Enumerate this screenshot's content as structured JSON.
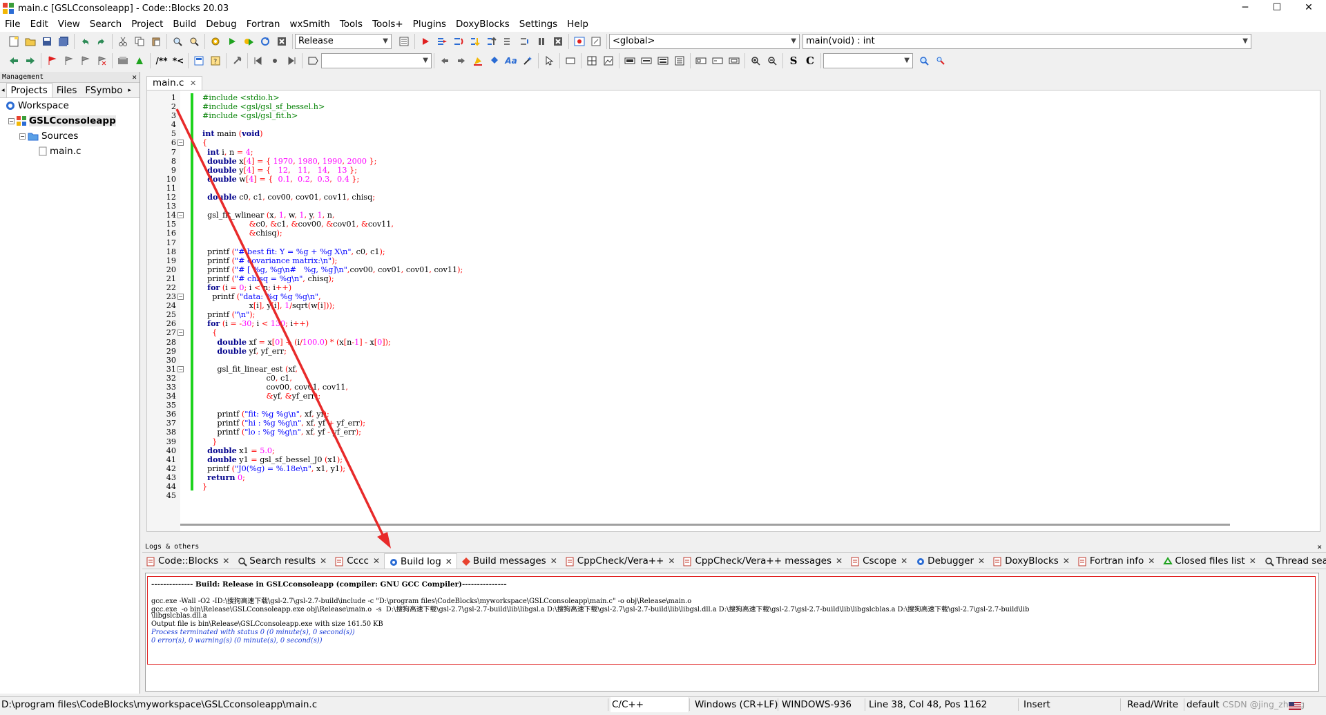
{
  "window": {
    "title": "main.c [GSLCconsoleapp] - Code::Blocks 20.03",
    "controls": [
      "─",
      "☐",
      "✕"
    ]
  },
  "menu": [
    "File",
    "Edit",
    "View",
    "Search",
    "Project",
    "Build",
    "Debug",
    "Fortran",
    "wxSmith",
    "Tools",
    "Tools+",
    "Plugins",
    "DoxyBlocks",
    "Settings",
    "Help"
  ],
  "toolbar": {
    "build_target": "Release",
    "scope": "<global>",
    "function": "main(void) : int",
    "search_value": "",
    "search2_value": ""
  },
  "management": {
    "title": "Management",
    "close": "✕",
    "tabs": [
      "Projects",
      "Files",
      "FSymbo"
    ],
    "tree": [
      {
        "label": "Workspace",
        "level": 0,
        "icon": "workspace-icon",
        "bold": false
      },
      {
        "label": "GSLCconsoleapp",
        "level": 1,
        "icon": "project-icon",
        "bold": true
      },
      {
        "label": "Sources",
        "level": 2,
        "icon": "folder-icon",
        "bold": false
      },
      {
        "label": "main.c",
        "level": 3,
        "icon": "file-icon",
        "bold": false
      }
    ]
  },
  "editor": {
    "tab": "main.c",
    "tab_close": "✕",
    "lines": [
      {
        "n": "1",
        "code": "#include <stdio.h>",
        "cls": "pp"
      },
      {
        "n": "2",
        "code": "#include <gsl/gsl_sf_bessel.h>",
        "cls": "pp"
      },
      {
        "n": "3",
        "code": "#include <gsl/gsl_fit.h>",
        "cls": "pp"
      },
      {
        "n": "4",
        "code": "",
        "cls": ""
      },
      {
        "n": "5",
        "code": "int main (void)",
        "cls": "mix"
      },
      {
        "n": "6",
        "code": "{",
        "cls": "op",
        "fold": "−"
      },
      {
        "n": "7",
        "code": "  int i, n = 4;",
        "cls": "mix"
      },
      {
        "n": "8",
        "code": "  double x[4] = { 1970, 1980, 1990, 2000 };",
        "cls": "mix"
      },
      {
        "n": "9",
        "code": "  double y[4] = {   12,   11,   14,   13 };",
        "cls": "mix"
      },
      {
        "n": "10",
        "code": "  double w[4] = {  0.1,  0.2,  0.3,  0.4 };",
        "cls": "mix"
      },
      {
        "n": "11",
        "code": "",
        "cls": ""
      },
      {
        "n": "12",
        "code": "  double c0, c1, cov00, cov01, cov11, chisq;",
        "cls": "mix"
      },
      {
        "n": "13",
        "code": "",
        "cls": ""
      },
      {
        "n": "14",
        "code": "  gsl_fit_wlinear (x, 1, w, 1, y, 1, n,",
        "cls": "mix",
        "fold": "−"
      },
      {
        "n": "15",
        "code": "                   &c0, &c1, &cov00, &cov01, &cov11,",
        "cls": "mix"
      },
      {
        "n": "16",
        "code": "                   &chisq);",
        "cls": "mix"
      },
      {
        "n": "17",
        "code": "",
        "cls": ""
      },
      {
        "n": "18",
        "code": "  printf (\"# best fit: Y = %g + %g X\\n\", c0, c1);",
        "cls": "mix"
      },
      {
        "n": "19",
        "code": "  printf (\"# covariance matrix:\\n\");",
        "cls": "mix"
      },
      {
        "n": "20",
        "code": "  printf (\"# [ %g, %g\\n#   %g, %g]\\n\",cov00, cov01, cov01, cov11);",
        "cls": "mix"
      },
      {
        "n": "21",
        "code": "  printf (\"# chisq = %g\\n\", chisq);",
        "cls": "mix"
      },
      {
        "n": "22",
        "code": "  for (i = 0; i < n; i++)",
        "cls": "mix"
      },
      {
        "n": "23",
        "code": "    printf (\"data: %g %g %g\\n\",",
        "cls": "mix",
        "fold": "−"
      },
      {
        "n": "24",
        "code": "                   x[i], y[i], 1/sqrt(w[i]));",
        "cls": "mix"
      },
      {
        "n": "25",
        "code": "  printf (\"\\n\");",
        "cls": "mix"
      },
      {
        "n": "26",
        "code": "  for (i = -30; i < 130; i++)",
        "cls": "mix"
      },
      {
        "n": "27",
        "code": "    {",
        "cls": "op",
        "fold": "−"
      },
      {
        "n": "28",
        "code": "      double xf = x[0] + (i/100.0) * (x[n-1] - x[0]);",
        "cls": "mix"
      },
      {
        "n": "29",
        "code": "      double yf, yf_err;",
        "cls": "mix"
      },
      {
        "n": "30",
        "code": "",
        "cls": ""
      },
      {
        "n": "31",
        "code": "      gsl_fit_linear_est (xf,",
        "cls": "mix",
        "fold": "−"
      },
      {
        "n": "32",
        "code": "                          c0, c1,",
        "cls": "mix"
      },
      {
        "n": "33",
        "code": "                          cov00, cov01, cov11,",
        "cls": "mix"
      },
      {
        "n": "34",
        "code": "                          &yf, &yf_err);",
        "cls": "mix"
      },
      {
        "n": "35",
        "code": "",
        "cls": ""
      },
      {
        "n": "36",
        "code": "      printf (\"fit: %g %g\\n\", xf, yf);",
        "cls": "mix"
      },
      {
        "n": "37",
        "code": "      printf (\"hi : %g %g\\n\", xf, yf + yf_err);",
        "cls": "mix"
      },
      {
        "n": "38",
        "code": "      printf (\"lo : %g %g\\n\", xf, yf - yf_err);",
        "cls": "mix"
      },
      {
        "n": "39",
        "code": "    }",
        "cls": "op"
      },
      {
        "n": "40",
        "code": "  double x1 = 5.0;",
        "cls": "mix"
      },
      {
        "n": "41",
        "code": "  double y1 = gsl_sf_bessel_J0 (x1);",
        "cls": "mix"
      },
      {
        "n": "42",
        "code": "  printf (\"J0(%g) = %.18e\\n\", x1, y1);",
        "cls": "mix"
      },
      {
        "n": "43",
        "code": "  return 0;",
        "cls": "mix"
      },
      {
        "n": "44",
        "code": "}",
        "cls": "op"
      },
      {
        "n": "45",
        "code": "",
        "cls": ""
      }
    ]
  },
  "logs": {
    "title": "Logs & others",
    "close": "✕",
    "tabs": [
      {
        "label": "Code::Blocks",
        "icon": "document-icon",
        "active": false
      },
      {
        "label": "Search results",
        "icon": "magnifier-icon",
        "active": false
      },
      {
        "label": "Cccc",
        "icon": "document-icon",
        "active": false
      },
      {
        "label": "Build log",
        "icon": "gear-icon",
        "active": true
      },
      {
        "label": "Build messages",
        "icon": "diamond-icon",
        "active": false
      },
      {
        "label": "CppCheck/Vera++",
        "icon": "document-icon",
        "active": false
      },
      {
        "label": "CppCheck/Vera++ messages",
        "icon": "document-icon",
        "active": false
      },
      {
        "label": "Cscope",
        "icon": "document-icon",
        "active": false
      },
      {
        "label": "Debugger",
        "icon": "gear-icon",
        "active": false
      },
      {
        "label": "DoxyBlocks",
        "icon": "document-icon",
        "active": false
      },
      {
        "label": "Fortran info",
        "icon": "document-icon",
        "active": false
      },
      {
        "label": "Closed files list",
        "icon": "recycle-icon",
        "active": false
      },
      {
        "label": "Thread search",
        "icon": "magnifier-icon",
        "active": false
      }
    ],
    "tab_close": "✕",
    "build_log": [
      {
        "text": "-------------- Build: Release in GSLCconsoleapp (compiler: GNU GCC Compiler)---------------",
        "style": "bold"
      },
      {
        "text": "gcc.exe -Wall -O2 -ID:\\搜狗高速下载\\gsl-2.7\\gsl-2.7-build\\include -c \"D:\\program files\\CodeBlocks\\myworkspace\\GSLCconsoleapp\\main.c\" -o obj\\Release\\main.o",
        "style": "normal"
      },
      {
        "text": "gcc.exe  -o bin\\Release\\GSLCconsoleapp.exe obj\\Release\\main.o  -s  D:\\搜狗高速下载\\gsl-2.7\\gsl-2.7-build\\lib\\libgsl.a D:\\搜狗高速下载\\gsl-2.7\\gsl-2.7-build\\lib\\libgsl.dll.a D:\\搜狗高速下载\\gsl-2.7\\gsl-2.7-build\\lib\\libgslcblas.a D:\\搜狗高速下载\\gsl-2.7\\gsl-2.7-build\\lib",
        "style": "normal"
      },
      {
        "text": "\\libgslcblas.dll.a",
        "style": "normal"
      },
      {
        "text": "Output file is bin\\Release\\GSLCconsoleapp.exe with size 161.50 KB",
        "style": "normal"
      },
      {
        "text": "Process terminated with status 0 (0 minute(s), 0 second(s))",
        "style": "blue"
      },
      {
        "text": "0 error(s), 0 warning(s) (0 minute(s), 0 second(s))",
        "style": "blue"
      }
    ]
  },
  "statusbar": {
    "path": "D:\\program files\\CodeBlocks\\myworkspace\\GSLCconsoleapp\\main.c",
    "language": "C/C++",
    "eol": "Windows (CR+LF)",
    "encoding": "WINDOWS-936",
    "position": "Line 38, Col 48, Pos 1162",
    "mode": "Insert",
    "access": "Read/Write",
    "profile": "default",
    "watermark": "CSDN @jing_zhong"
  },
  "colors": {
    "changebar": "#1ed31e",
    "annotation_arrow": "#e82a2a",
    "keyword": "#00008b",
    "preprocessor": "#008000",
    "number": "#ff00ff"
  }
}
